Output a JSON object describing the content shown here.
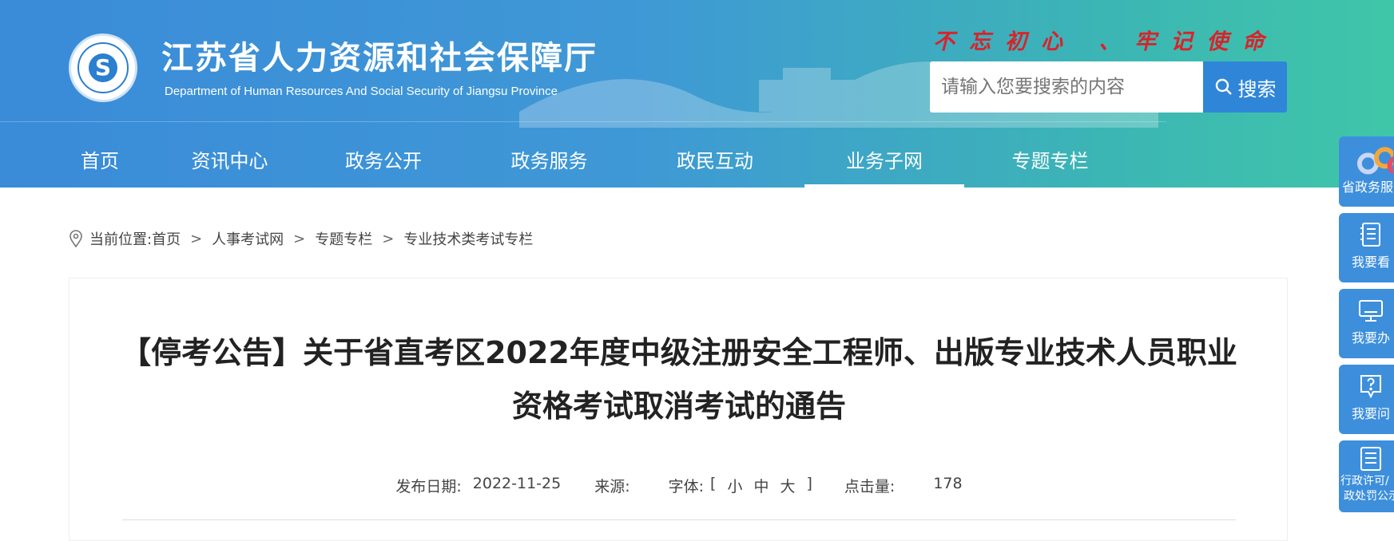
{
  "header": {
    "title": "江苏省人力资源和社会保障厅",
    "subtitle": "Department of Human Resources And Social Security of Jiangsu Province",
    "slogan": "不忘初心 、牢记使命",
    "logo_icon": "seal-logo-icon",
    "search": {
      "placeholder": "请输入您要搜索的内容",
      "button_label": "搜索",
      "icon": "search-icon"
    }
  },
  "nav": {
    "items": [
      {
        "label": "首页"
      },
      {
        "label": "资讯中心"
      },
      {
        "label": "政务公开"
      },
      {
        "label": "政务服务"
      },
      {
        "label": "政民互动"
      },
      {
        "label": "业务子网"
      },
      {
        "label": "专题专栏"
      }
    ],
    "active": "业务子网"
  },
  "breadcrumb": {
    "prefix": "当前位置:",
    "items": [
      "首页",
      "人事考试网",
      "专题专栏",
      "专业技术类考试专栏"
    ],
    "separator": ">"
  },
  "article": {
    "title_line1": "【停考公告】关于省直考区2022年度中级注册安全工程师、出版专业技术人员职业",
    "title_line2": "资格考试取消考试的通告",
    "meta": {
      "date_label": "发布日期:",
      "date": "2022-11-25",
      "source_label": "来源:",
      "source": "",
      "font_label": "字体:",
      "font_open": "[",
      "font_small": "小",
      "font_medium": "中",
      "font_large": "大",
      "font_close": "]",
      "hits_label": "点击量:",
      "hits": "178"
    }
  },
  "side_bar": {
    "items": [
      {
        "label": "省政务服务",
        "icon": "gov-service-logo-icon"
      },
      {
        "label": "我要看",
        "icon": "notebook-icon"
      },
      {
        "label": "我要办",
        "icon": "monitor-icon"
      },
      {
        "label": "我要问",
        "icon": "question-bubble-icon"
      },
      {
        "label_line1": "行政许可/",
        "label_line2": "政处罚公示",
        "icon": "document-list-icon"
      }
    ]
  },
  "colors": {
    "header_gradient_start": "#3a8bd8",
    "header_gradient_end": "#3fc6a8",
    "slogan_red": "#d8232a",
    "search_button": "#2f86d8",
    "side_bar_blue": "#3d8fdc"
  }
}
